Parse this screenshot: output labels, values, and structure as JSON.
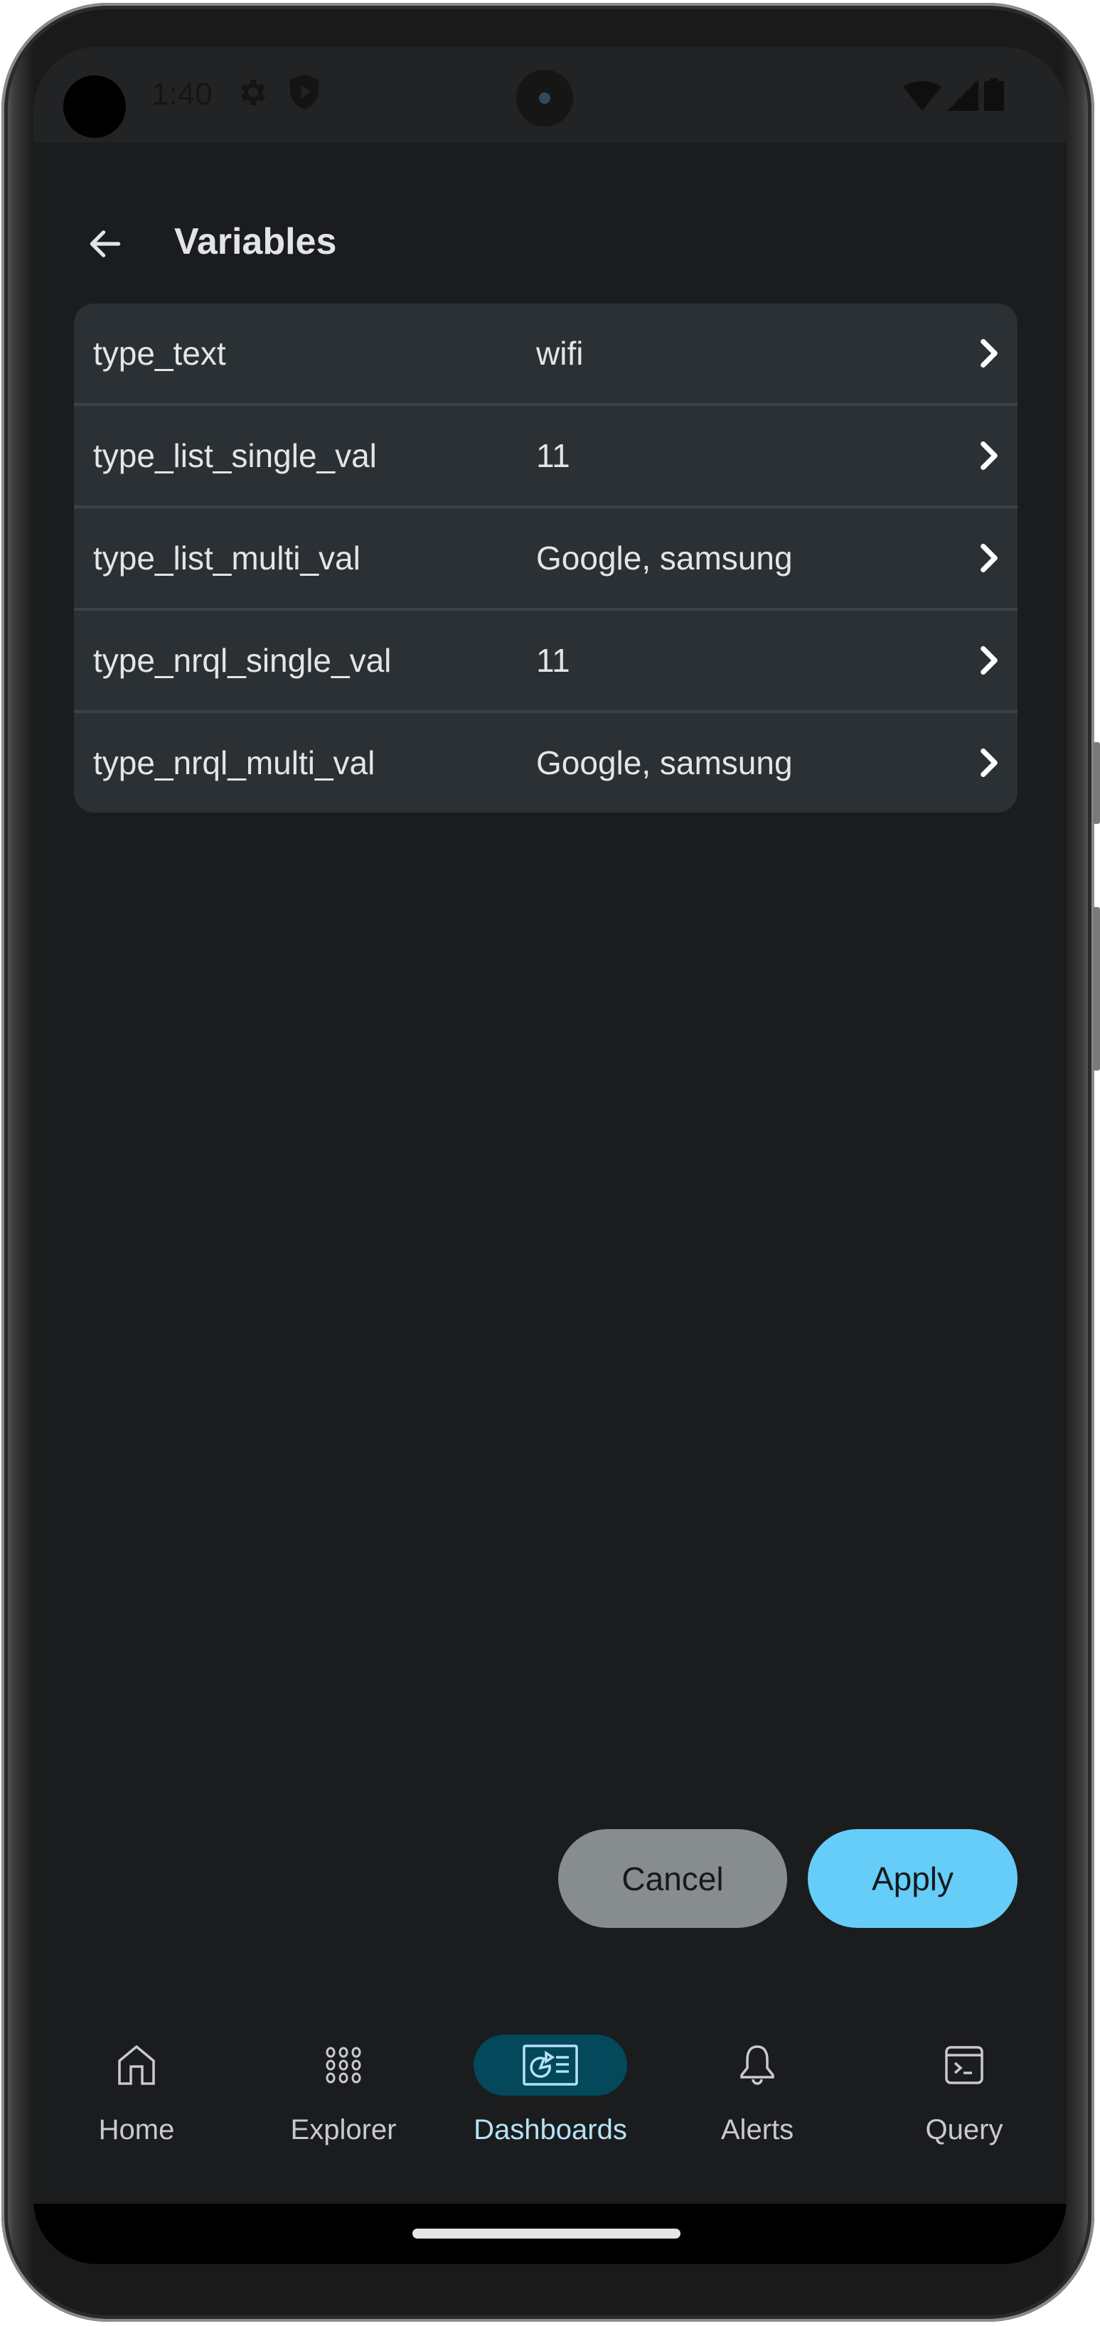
{
  "status_bar": {
    "time": "1:40",
    "icons": [
      "settings-gear-icon",
      "shield-play-icon",
      "wifi-icon",
      "signal-icon",
      "battery-icon"
    ]
  },
  "header": {
    "back_icon": "arrow-left-icon",
    "title": "Variables"
  },
  "variables": [
    {
      "name": "type_text",
      "value": "wifi"
    },
    {
      "name": "type_list_single_val",
      "value": "11"
    },
    {
      "name": "type_list_multi_val",
      "value": "Google, samsung"
    },
    {
      "name": "type_nrql_single_val",
      "value": "11"
    },
    {
      "name": "type_nrql_multi_val",
      "value": "Google, samsung"
    }
  ],
  "actions": {
    "cancel_label": "Cancel",
    "apply_label": "Apply"
  },
  "bottom_nav": {
    "active": "Dashboards",
    "items": [
      {
        "label": "Home",
        "icon": "home-icon"
      },
      {
        "label": "Explorer",
        "icon": "grid-dots-icon"
      },
      {
        "label": "Dashboards",
        "icon": "dashboard-icon"
      },
      {
        "label": "Alerts",
        "icon": "bell-icon"
      },
      {
        "label": "Query",
        "icon": "terminal-icon"
      }
    ]
  },
  "colors": {
    "background": "#1b1c1e",
    "card": "#2a3033",
    "divider": "#3b4245",
    "apply": "#66cdf9",
    "cancel": "#878c8f",
    "nav_active_pill": "#03485b",
    "nav_active_label": "#b5e3f7"
  }
}
